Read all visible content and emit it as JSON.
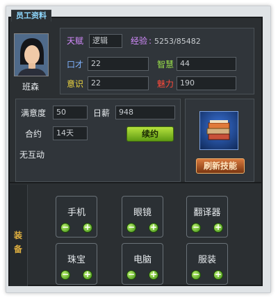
{
  "window": {
    "title": "员工资料"
  },
  "employee": {
    "name": "班森",
    "talent_label": "天赋",
    "talent_value": "逻辑",
    "exp_label": "经验",
    "exp_value": "5253/85482",
    "eloquence_label": "口才",
    "eloquence_value": "22",
    "intelligence_label": "智慧",
    "intelligence_value": "44",
    "awareness_label": "意识",
    "awareness_value": "22",
    "charm_label": "魅力",
    "charm_value": "190"
  },
  "contract": {
    "satisfaction_label": "满意度",
    "satisfaction_value": "50",
    "salary_label": "日薪",
    "salary_value": "948",
    "term_label": "合约",
    "term_value": "14天",
    "renew_button": "续约",
    "interaction_status": "无互动"
  },
  "skills": {
    "refresh_button": "刷新技能"
  },
  "equipment": {
    "side_tab_chars": [
      "装",
      "备"
    ],
    "slots": [
      {
        "label": "手机"
      },
      {
        "label": "眼镜"
      },
      {
        "label": "翻译器"
      },
      {
        "label": "珠宝"
      },
      {
        "label": "电脑"
      },
      {
        "label": "服装"
      }
    ],
    "minus": "−",
    "plus": "+"
  },
  "colors": {
    "talent": "#d58cff",
    "exp": "#d58cff",
    "eloquence": "#7fb3ff",
    "intelligence": "#9be24a",
    "awareness": "#f0d840",
    "charm": "#ff4a3a"
  }
}
